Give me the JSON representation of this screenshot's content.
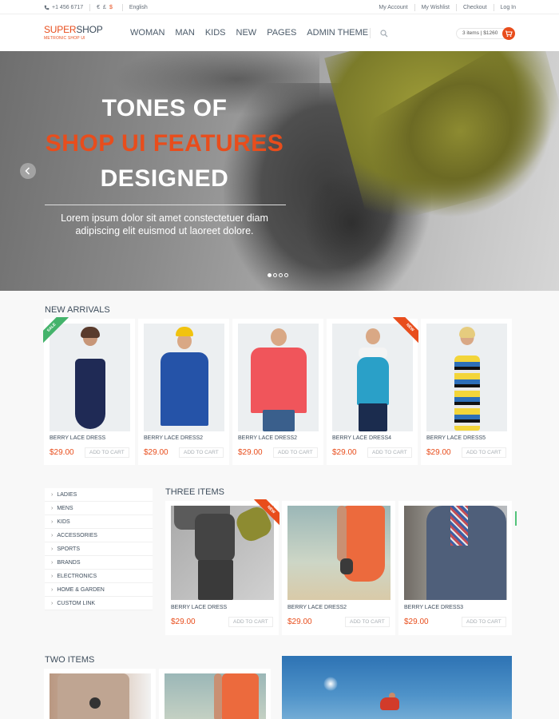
{
  "topbar": {
    "phone": "+1 456 6717",
    "currencies": [
      "€",
      "£",
      "$"
    ],
    "language": "English",
    "links": [
      "My Account",
      "My Wishlist",
      "Checkout",
      "Log In"
    ]
  },
  "header": {
    "logo_super": "SUPER",
    "logo_shop": "SHOP",
    "logo_tagline": "METRONIC SHOP UI",
    "nav": [
      "WOMAN",
      "MAN",
      "KIDS",
      "NEW",
      "PAGES",
      "ADMIN THEME"
    ],
    "cart_summary": "3 items | $1260"
  },
  "hero": {
    "line1": "TONES OF",
    "line2": "SHOP UI FEATURES",
    "line3": "DESIGNED",
    "subtitle_1": "Lorem ipsum dolor sit amet constectetuer diam",
    "subtitle_2": "adipiscing elit euismod ut laoreet dolore.",
    "slides_count": 4,
    "active_slide": 1
  },
  "new_arrivals": {
    "title": "NEW ARRIVALS",
    "add_label": "ADD TO CART",
    "items": [
      {
        "name": "BERRY LACE DRESS",
        "price": "$29.00",
        "badge": "SALE"
      },
      {
        "name": "BERRY LACE DRESS2",
        "price": "$29.00",
        "badge": ""
      },
      {
        "name": "BERRY LACE DRESS2",
        "price": "$29.00",
        "badge": ""
      },
      {
        "name": "BERRY LACE DRESS4",
        "price": "$29.00",
        "badge": "NEW"
      },
      {
        "name": "BERRY LACE DRESS5",
        "price": "$29.00",
        "badge": ""
      }
    ]
  },
  "sidebar": {
    "items": [
      "LADIES",
      "MENS",
      "KIDS",
      "ACCESSORIES",
      "SPORTS",
      "BRANDS",
      "ELECTRONICS",
      "HOME & GARDEN",
      "CUSTOM LINK"
    ]
  },
  "three_items": {
    "title": "THREE ITEMS",
    "add_label": "ADD TO CART",
    "items": [
      {
        "name": "BERRY LACE DRESS",
        "price": "$29.00",
        "badge": "NEW"
      },
      {
        "name": "BERRY LACE DRESS2",
        "price": "$29.00",
        "badge": ""
      },
      {
        "name": "BERRY LACE DRESS3",
        "price": "$29.00",
        "badge": ""
      }
    ]
  },
  "two_items": {
    "title": "TWO ITEMS"
  },
  "colors": {
    "accent": "#e84d1c",
    "sale": "#44b36b",
    "text": "#3e4d5c"
  }
}
